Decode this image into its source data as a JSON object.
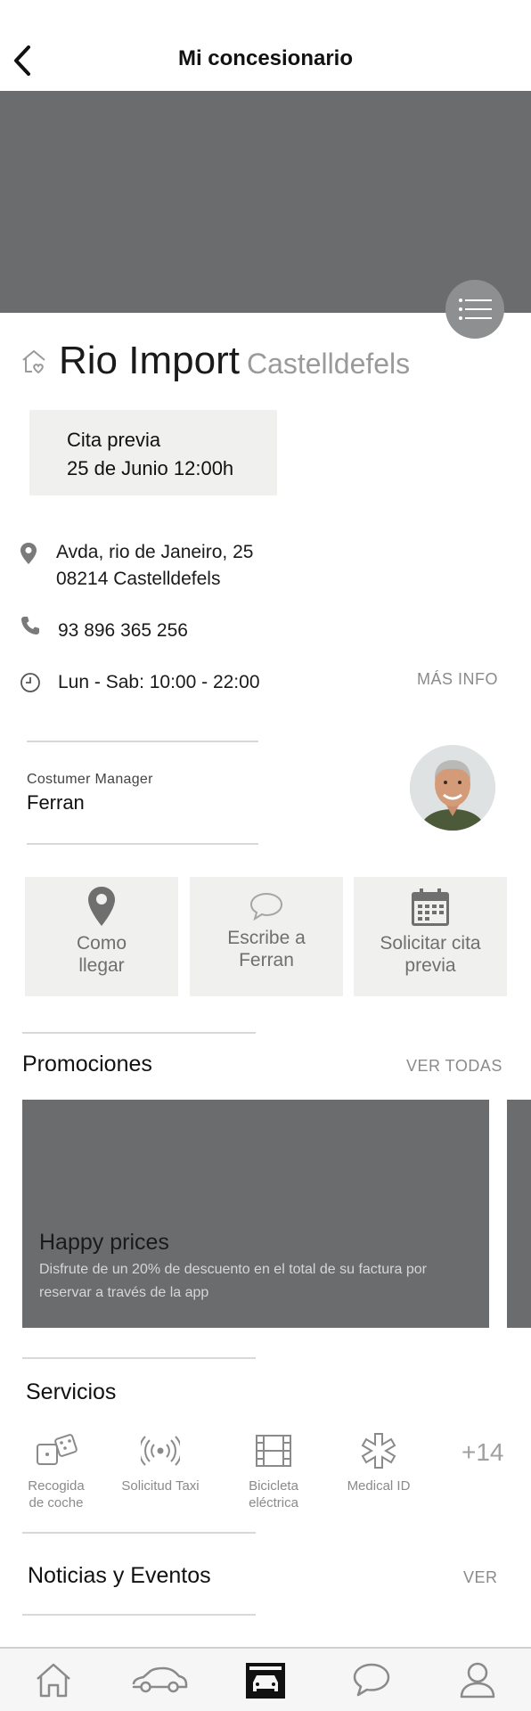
{
  "header": {
    "title": "Mi concesionario"
  },
  "dealer": {
    "name": "Rio Import",
    "city": "Castelldefels"
  },
  "appointment": {
    "label": "Cita previa",
    "datetime": "25 de Junio 12:00h"
  },
  "address": {
    "line1": "Avda, rio de Janeiro, 25",
    "line2": "08214 Castelldefels"
  },
  "phone": "93 896 365 256",
  "hours": "Lun - Sab: 10:00 - 22:00",
  "more_info_label": "MÁS INFO",
  "manager": {
    "role": "Costumer Manager",
    "name": "Ferran"
  },
  "actions": [
    {
      "label_line1": "Como",
      "label_line2": "llegar",
      "icon": "location-pin-icon"
    },
    {
      "label_line1": "Escribe a",
      "label_line2": "Ferran",
      "icon": "chat-bubble-icon"
    },
    {
      "label_line1": "Solicitar cita",
      "label_line2": "previa",
      "icon": "calendar-icon"
    }
  ],
  "promotions": {
    "title": "Promociones",
    "see_all": "VER TODAS",
    "items": [
      {
        "title": "Happy prices",
        "description": "Disfrute de un 20% de descuento en el total de su factura por reservar a través de la app"
      }
    ]
  },
  "services": {
    "title": "Servicios",
    "items": [
      {
        "line1": "Recogida",
        "line2": "de coche",
        "icon": "dice-icon"
      },
      {
        "line1": "Solicitud Taxi",
        "line2": "",
        "icon": "radio-signal-icon"
      },
      {
        "line1": "Bicicleta",
        "line2": "eléctrica",
        "icon": "film-strip-icon"
      },
      {
        "line1": "Medical ID",
        "line2": "",
        "icon": "medical-star-icon"
      }
    ],
    "more": "+14"
  },
  "news": {
    "title": "Noticias y Eventos",
    "see_all": "VER"
  },
  "tabbar": {
    "items": [
      {
        "icon": "home-icon",
        "active": false
      },
      {
        "icon": "car-icon",
        "active": false
      },
      {
        "icon": "dealer-garage-icon",
        "active": true
      },
      {
        "icon": "chat-icon",
        "active": false
      },
      {
        "icon": "profile-icon",
        "active": false
      }
    ]
  },
  "colors": {
    "hero_gray": "#6b6c6e",
    "card_gray": "#f0f0ef",
    "muted_text": "#8a8a8a"
  }
}
